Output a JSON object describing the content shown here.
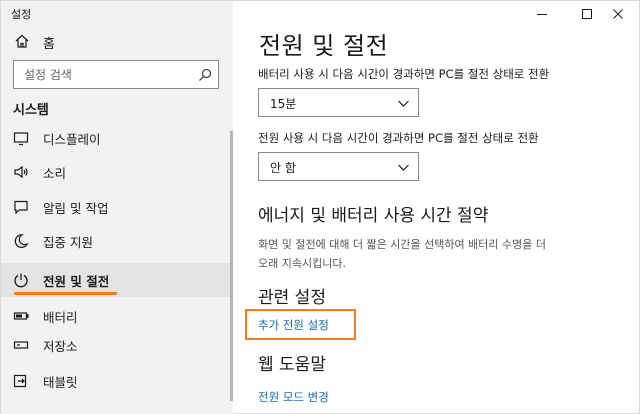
{
  "window": {
    "title": "설정",
    "controls": [
      "minimize",
      "maximize",
      "close"
    ]
  },
  "sidebar": {
    "home_label": "홈",
    "home_icon": "home-icon",
    "search": {
      "placeholder": "설정 검색",
      "icon": "search-icon"
    },
    "section_label": "시스템",
    "items": [
      {
        "label": "디스플레이",
        "icon": "display-icon",
        "selected": false
      },
      {
        "label": "소리",
        "icon": "speaker-icon",
        "selected": false
      },
      {
        "label": "알림 및 작업",
        "icon": "notification-icon",
        "selected": false
      },
      {
        "label": "집중 지원",
        "icon": "moon-icon",
        "selected": false
      },
      {
        "label": "전원 및 절전",
        "icon": "power-icon",
        "selected": true
      },
      {
        "label": "배터리",
        "icon": "battery-icon",
        "selected": false
      },
      {
        "label": "저장소",
        "icon": "storage-icon",
        "selected": false
      },
      {
        "label": "태블릿",
        "icon": "tablet-icon",
        "selected": false
      }
    ]
  },
  "main": {
    "title": "전원 및 절전",
    "battery_sleep": {
      "label": "배터리 사용 시 다음 시간이 경과하면 PC를 절전 상태로 전환",
      "value": "15분"
    },
    "plugged_sleep": {
      "label": "전원 사용 시 다음 시간이 경과하면 PC를 절전 상태로 전환",
      "value": "안 함"
    },
    "energy_section": {
      "header": "에너지 및 배터리 사용 시간 절약",
      "text_line1": "화면 및 절전에 대해 더 짧은 시간을 선택하여 배터리 수명을 더",
      "text_line2": "오래 지속시킵니다."
    },
    "related": {
      "header": "관련 설정",
      "link": "추가 전원 설정"
    },
    "web_help": {
      "header": "웹 도움말",
      "link": "전원 모드 변경"
    }
  },
  "colors": {
    "accent_highlight": "#f07d1f",
    "link": "#1a6ab5",
    "sidebar_bg": "#f2f2f2"
  }
}
